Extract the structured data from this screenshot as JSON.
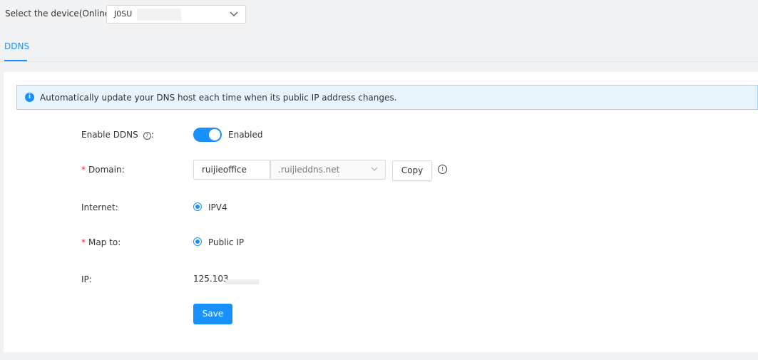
{
  "device": {
    "label": "Select the device(Online):",
    "selected_value": "J0SU"
  },
  "tabs": [
    {
      "label": "DDNS",
      "active": true
    }
  ],
  "alert": {
    "message": "Automatically update your DNS host each time when its public IP address changes.",
    "icon": "info-icon"
  },
  "form": {
    "enable_ddns": {
      "label": "Enable DDNS",
      "colon": ":",
      "state_label": "Enabled",
      "enabled": true
    },
    "domain": {
      "required_mark": "*",
      "label": "Domain",
      "colon": ":",
      "value": "ruijieoffice",
      "suffix": ".ruijieddns.net",
      "copy_label": "Copy"
    },
    "internet": {
      "label": "Internet",
      "colon": ":",
      "option": "IPV4",
      "selected": true
    },
    "map_to": {
      "required_mark": "*",
      "label": "Map to",
      "colon": ":",
      "option": "Public IP",
      "selected": true
    },
    "ip": {
      "label": "IP",
      "colon": ":",
      "value": "125.103"
    },
    "save_label": "Save"
  },
  "colors": {
    "accent": "#1890ff",
    "alert_bg": "#e8f4fc",
    "alert_border": "#a3d3f5",
    "required": "#f5222d",
    "page_bg": "#f1f2f4"
  }
}
